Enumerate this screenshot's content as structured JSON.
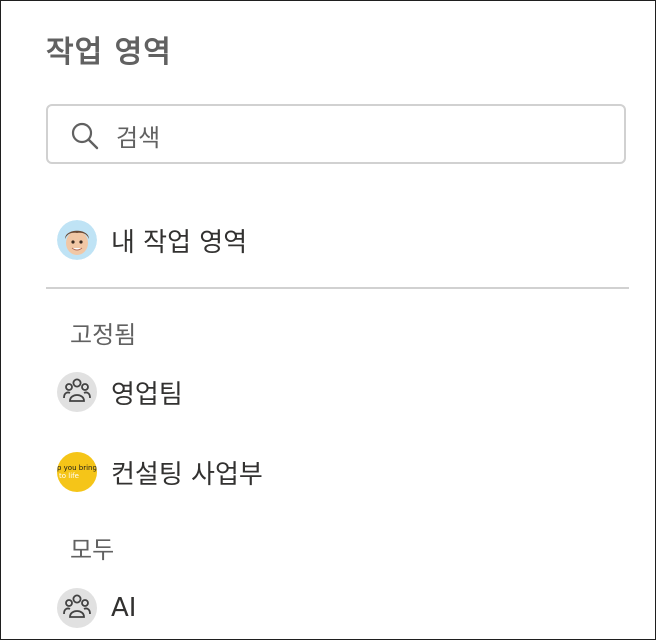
{
  "header": {
    "title": "작업 영역"
  },
  "search": {
    "placeholder": "검색"
  },
  "my_workspace": {
    "label": "내 작업 영역",
    "avatar_icon": "memoji-avatar-icon"
  },
  "sections": {
    "pinned": {
      "title": "고정됨",
      "items": [
        {
          "label": "영업팀",
          "icon": "group-icon"
        },
        {
          "label": "컨설팅 사업부",
          "icon": "logo-icon",
          "logo_text_1": "p you bring",
          "logo_text_2": "to life"
        }
      ]
    },
    "all": {
      "title": "모두",
      "items": [
        {
          "label": "AI",
          "icon": "group-icon"
        }
      ]
    }
  },
  "colors": {
    "text_primary": "#323130",
    "text_secondary": "#616161",
    "border": "#d1d1d1",
    "logo_yellow": "#f5c518",
    "group_icon_bg": "#e1e1e1"
  }
}
